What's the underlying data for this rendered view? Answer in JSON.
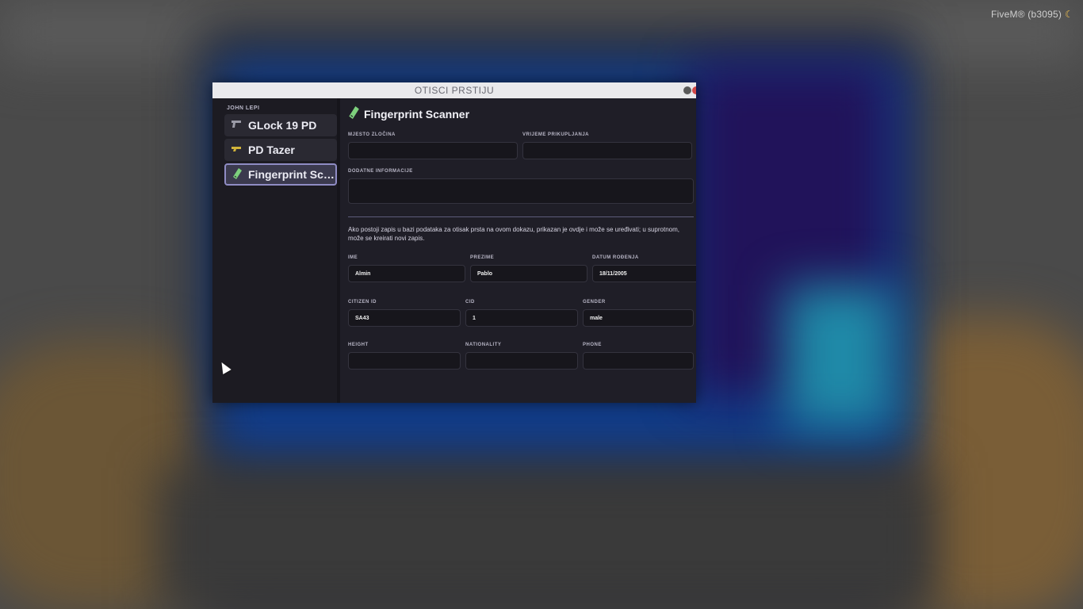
{
  "overlay": {
    "fivem_build": "FiveM® (b3095)"
  },
  "window": {
    "title": "OTISCI PRSTIJU"
  },
  "sidebar": {
    "owner": "JOHN LEPI",
    "items": [
      {
        "label": "GLock 19 PD",
        "icon": "pistol-icon"
      },
      {
        "label": "PD Tazer",
        "icon": "taser-icon"
      },
      {
        "label": "Fingerprint Scanner",
        "icon": "fingerprint-scanner-icon",
        "active": true
      }
    ]
  },
  "main": {
    "title": "Fingerprint Scanner",
    "fields": {
      "location_label": "MJESTO ZLOČINA",
      "location_value": "",
      "time_label": "VRIJEME PRIKUPLJANJA",
      "time_value": "",
      "info_label": "DODATNE INFORMACIJE",
      "info_value": ""
    },
    "note": "Ako postoji zapis u bazi podataka za otisak prsta na ovom dokazu, prikazan je ovdje i može se uređivati; u suprotnom, može se kreirati novi zapis.",
    "record": {
      "ime_label": "IME",
      "ime_value": "Almin",
      "prezime_label": "PREZIME",
      "prezime_value": "Pablo",
      "dob_label": "DATUM ROĐENJA",
      "dob_value": "18/11/2005",
      "citizen_label": "CITIZEN ID",
      "citizen_value": "SA43",
      "cid_label": "CID",
      "cid_value": "1",
      "gender_label": "GENDER",
      "gender_value": "male",
      "height_label": "HEIGHT",
      "height_value": "",
      "nationality_label": "NATIONALITY",
      "nationality_value": "",
      "phone_label": "PHONE",
      "phone_value": ""
    }
  }
}
